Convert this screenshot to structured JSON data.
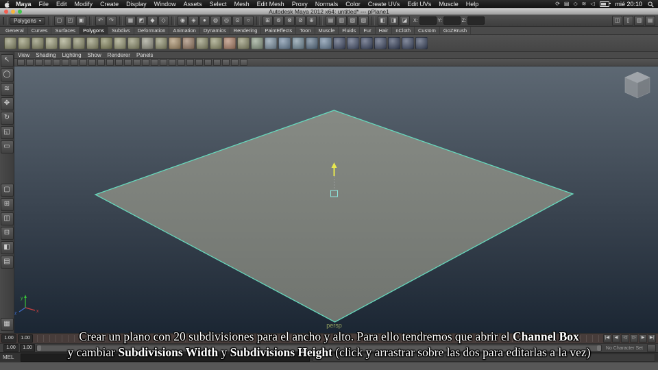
{
  "menubar": {
    "items": [
      "Maya",
      "File",
      "Edit",
      "Modify",
      "Create",
      "Display",
      "Window",
      "Assets",
      "Select",
      "Mesh",
      "Edit Mesh",
      "Proxy",
      "Normals",
      "Color",
      "Create UVs",
      "Edit UVs",
      "Muscle",
      "Help"
    ],
    "status_icons": [
      {
        "name": "sync-menu-icon",
        "glyph": "⟳"
      },
      {
        "name": "display-menu-icon",
        "glyph": "▤"
      },
      {
        "name": "bluetooth-icon",
        "glyph": "◇"
      },
      {
        "name": "wifi-icon",
        "glyph": "≋"
      },
      {
        "name": "volume-icon",
        "glyph": "◁"
      }
    ],
    "clock": "mié 20:10"
  },
  "titlebar": {
    "title": "Autodesk Maya 2012 x64: untitled* --- pPlane1"
  },
  "statusline": {
    "mode_selector": "Polygons",
    "dropdown_arrow": "▾",
    "groups": [
      {
        "name": "file-buttons",
        "icons": [
          {
            "name": "new-scene-icon",
            "g": "▢"
          },
          {
            "name": "open-scene-icon",
            "g": "◰"
          },
          {
            "name": "save-scene-icon",
            "g": "▣"
          }
        ]
      },
      {
        "name": "undo-redo",
        "icons": [
          {
            "name": "undo-icon",
            "g": "↶"
          },
          {
            "name": "redo-icon",
            "g": "↷"
          }
        ]
      },
      {
        "name": "selection-modes",
        "icons": [
          {
            "name": "select-hierarchy-icon",
            "g": "▦"
          },
          {
            "name": "select-object-icon",
            "g": "◩"
          },
          {
            "name": "select-component-icon",
            "g": "◆"
          },
          {
            "name": "select-mask-icon",
            "g": "◇"
          }
        ]
      },
      {
        "name": "selection-masks",
        "icons": [
          {
            "name": "mask-points-icon",
            "g": "◉"
          },
          {
            "name": "mask-curves-icon",
            "g": "◈"
          },
          {
            "name": "mask-surfaces-icon",
            "g": "●"
          },
          {
            "name": "mask-deformers-icon",
            "g": "◍"
          },
          {
            "name": "mask-dynamics-icon",
            "g": "◎"
          },
          {
            "name": "mask-rendering-icon",
            "g": "⊙"
          },
          {
            "name": "mask-misc-icon",
            "g": "○"
          }
        ]
      },
      {
        "name": "snapping",
        "icons": [
          {
            "name": "snap-grid-icon",
            "g": "⊞"
          },
          {
            "name": "snap-curve-icon",
            "g": "⊚"
          },
          {
            "name": "snap-point-icon",
            "g": "⊗"
          },
          {
            "name": "snap-plane-icon",
            "g": "⊘"
          },
          {
            "name": "snap-surface-icon",
            "g": "⊕"
          }
        ]
      },
      {
        "name": "history",
        "icons": [
          {
            "name": "input-connections-icon",
            "g": "▤"
          },
          {
            "name": "output-connections-icon",
            "g": "▥"
          },
          {
            "name": "construction-history-icon",
            "g": "▧"
          },
          {
            "name": "list-inputs-icon",
            "g": "▨"
          }
        ]
      },
      {
        "name": "render-buttons",
        "icons": [
          {
            "name": "render-icon",
            "g": "◧"
          },
          {
            "name": "ipr-render-icon",
            "g": "◨"
          },
          {
            "name": "render-settings-icon",
            "g": "◪"
          }
        ]
      }
    ],
    "coord_entry": {
      "labels": [
        "X:",
        "Y:",
        "Z:"
      ],
      "values": [
        "",
        "",
        ""
      ]
    },
    "right_icons": [
      {
        "name": "attribute-editor-toggle-icon",
        "g": "◫"
      },
      {
        "name": "tool-settings-toggle-icon",
        "g": "▯"
      },
      {
        "name": "channel-box-toggle-icon",
        "g": "▥"
      },
      {
        "name": "sidebar-toggle-icon",
        "g": "▤"
      }
    ]
  },
  "shelf": {
    "tabs": [
      "General",
      "Curves",
      "Surfaces",
      "Polygons",
      "Subdivs",
      "Deformation",
      "Animation",
      "Dynamics",
      "Rendering",
      "PaintEffects",
      "Toon",
      "Muscle",
      "Fluids",
      "Fur",
      "Hair",
      "nCloth",
      "Custom",
      "GoZBrush"
    ],
    "active_tab": "Polygons",
    "icon_colors": [
      "#8e8f6d",
      "#93946f",
      "#898a68",
      "#9b9c79",
      "#a3a482",
      "#8e8f6d",
      "#90916f",
      "#87885f",
      "#9b9c79",
      "#8e8f6d",
      "#9a9a8a",
      "#90916f",
      "#a98f6a",
      "#9c7f68",
      "#8e8f6d",
      "#93946f",
      "#b0836a",
      "#8e8f6d",
      "#90a08a",
      "#7f94a5",
      "#6f87a0",
      "#78909f",
      "#5d7389",
      "#6f87a0",
      "#46506b",
      "#4a5570",
      "#3f4a66",
      "#46506b",
      "#39445f",
      "#424d68",
      "#3e4963"
    ]
  },
  "panel": {
    "menu_items": [
      "View",
      "Shading",
      "Lighting",
      "Show",
      "Renderer",
      "Panels"
    ],
    "toolbar_icon_count": 26,
    "camera_label": "persp"
  },
  "toolbox": {
    "tools": [
      {
        "name": "select-tool",
        "g": "↖"
      },
      {
        "name": "lasso-select-tool",
        "g": "◯"
      },
      {
        "name": "paint-select-tool",
        "g": "≋"
      },
      {
        "name": "move-tool",
        "g": "✥"
      },
      {
        "name": "rotate-tool",
        "g": "↻"
      },
      {
        "name": "scale-tool",
        "g": "◱"
      },
      {
        "name": "last-tool-slot",
        "g": "▭"
      }
    ],
    "layouts": [
      {
        "name": "layout-single-pane",
        "g": "▢"
      },
      {
        "name": "layout-four-pane",
        "g": "⊞"
      },
      {
        "name": "layout-two-side",
        "g": "◫"
      },
      {
        "name": "layout-two-stacked",
        "g": "⊟"
      },
      {
        "name": "layout-persp-outliner",
        "g": "◧"
      },
      {
        "name": "layout-hypershade",
        "g": "▤"
      }
    ]
  },
  "colors": {
    "plane_fill_top": "#868a84",
    "plane_fill_bottom": "#70746f",
    "plane_edge": "#66d8bc",
    "manipulator_y": "#e8e84f",
    "camera_label": "#92a05e"
  },
  "timeline": {
    "time_fields": [
      "1.00",
      "1.00"
    ],
    "range_fields": [
      "1.00",
      "1.00"
    ],
    "playback": [
      "|◀",
      "◀",
      "◁",
      "▷",
      "▶",
      "▶|"
    ],
    "character_set": "No Character Set"
  },
  "commandline": {
    "label": "MEL"
  },
  "subtitle": {
    "line1": [
      {
        "t": "Crear un plano con 20 subdivisiones para el ancho y alto. Para ello tendremos que abrir el ",
        "b": false
      },
      {
        "t": "Channel Box",
        "b": true
      }
    ],
    "line2": [
      {
        "t": "y cambiar ",
        "b": false
      },
      {
        "t": "Subdivisions Width",
        "b": true
      },
      {
        "t": " y ",
        "b": false
      },
      {
        "t": "Subdivisions Height",
        "b": true
      },
      {
        "t": " (click y arrastrar sobre las dos para editarlas a la vez)",
        "b": false
      }
    ]
  }
}
